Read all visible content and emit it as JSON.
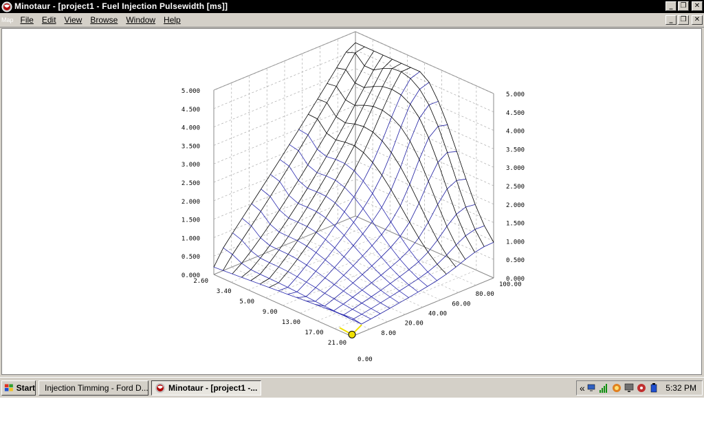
{
  "window": {
    "title": "Minotaur - [project1 - Fuel Injection Pulsewidth [ms]]",
    "mdi_label": "Map"
  },
  "menu": {
    "items": [
      "File",
      "Edit",
      "View",
      "Browse",
      "Window",
      "Help"
    ]
  },
  "chart_data": {
    "type": "surface3d",
    "title": "Fuel Injection Pulsewidth [ms]",
    "z_ticks": [
      "0.000",
      "0.500",
      "1.000",
      "1.500",
      "2.000",
      "2.500",
      "3.000",
      "3.500",
      "4.000",
      "4.500",
      "5.000"
    ],
    "z_range": [
      0,
      5
    ],
    "x_ticks": [
      "2.60",
      "3.40",
      "5.00",
      "9.00",
      "13.00",
      "17.00",
      "21.00"
    ],
    "y_ticks": [
      "0.00",
      "8.00",
      "20.00",
      "40.00",
      "60.00",
      "80.00",
      "100.00"
    ],
    "grid": true,
    "grid_size": [
      16,
      16
    ],
    "surface": "pulsewidth rises with load (axis 0-100) and falls at high engine speed (axis 2.60-21.00); peak about 4.6 ms, floor about 0.2 ms"
  },
  "taskbar": {
    "start_label": "Start",
    "tasks": [
      {
        "label": "Injection Timming - Ford D...",
        "active": false
      },
      {
        "label": "Minotaur - [project1 -...",
        "active": true
      }
    ],
    "tray_chevron": "«",
    "clock": "5:32 PM"
  }
}
